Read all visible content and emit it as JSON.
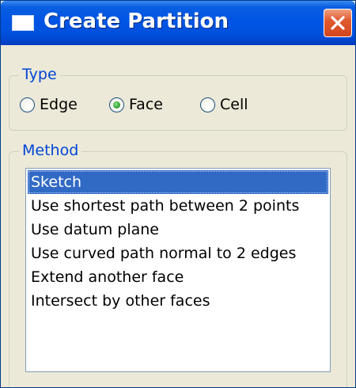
{
  "window": {
    "title": "Create Partition",
    "title_icon": "window-icon",
    "close_icon": "close-icon"
  },
  "type_group": {
    "label": "Type",
    "options": [
      {
        "label": "Edge",
        "checked": false
      },
      {
        "label": "Face",
        "checked": true
      },
      {
        "label": "Cell",
        "checked": false
      }
    ]
  },
  "method_group": {
    "label": "Method",
    "items": [
      {
        "label": "Sketch",
        "selected": true
      },
      {
        "label": "Use shortest path between 2 points",
        "selected": false
      },
      {
        "label": "Use datum plane",
        "selected": false
      },
      {
        "label": "Use curved path normal to 2 edges",
        "selected": false
      },
      {
        "label": "Extend another face",
        "selected": false
      },
      {
        "label": "Intersect by other faces",
        "selected": false
      }
    ]
  },
  "colors": {
    "titlebar": "#0055e5",
    "selection": "#316ac5",
    "group_label": "#0046d5",
    "dialog_bg": "#ece9d8"
  }
}
